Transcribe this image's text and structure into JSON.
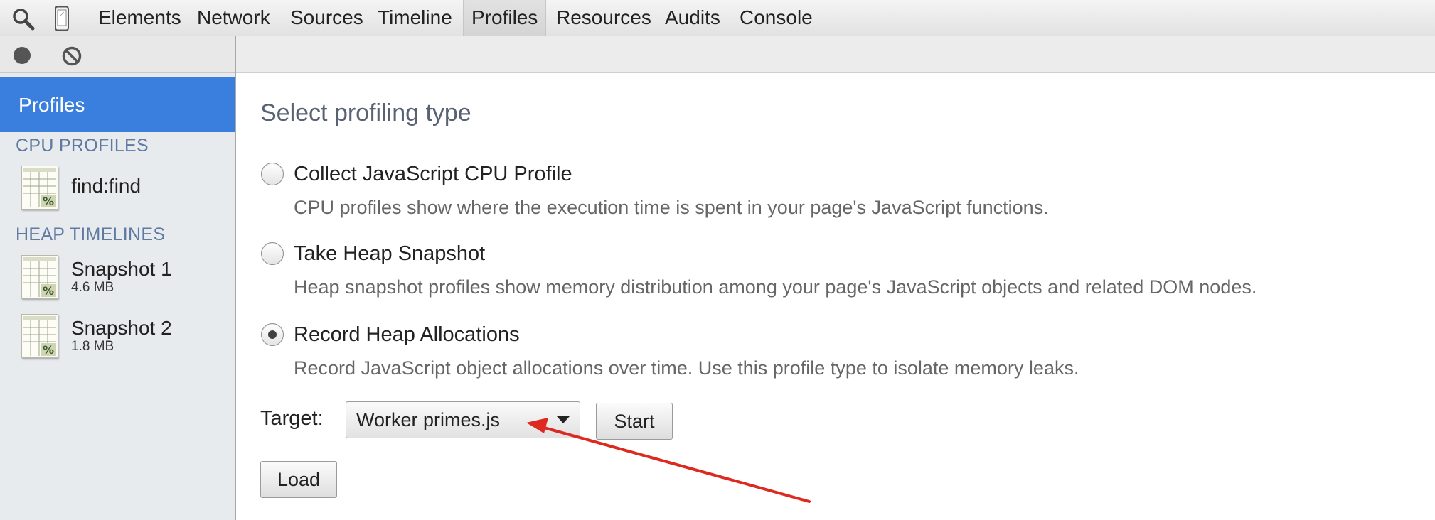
{
  "toolbar": {
    "icons": [
      "search-icon",
      "device-mode-icon"
    ],
    "tabs": [
      {
        "label": "Elements"
      },
      {
        "label": "Network"
      },
      {
        "label": "Sources"
      },
      {
        "label": "Timeline"
      },
      {
        "label": "Profiles",
        "active": true
      },
      {
        "label": "Resources"
      },
      {
        "label": "Audits"
      },
      {
        "label": "Console"
      }
    ]
  },
  "sidebar": {
    "toolbar_icons": [
      "record-icon",
      "clear-icon"
    ],
    "selected": "Profiles",
    "sections": [
      {
        "title": "CPU PROFILES",
        "items": [
          {
            "title": "find:find",
            "icon": "profile-icon"
          }
        ]
      },
      {
        "title": "HEAP TIMELINES",
        "items": [
          {
            "title": "Snapshot 1",
            "subtitle": "4.6 MB",
            "icon": "profile-icon"
          },
          {
            "title": "Snapshot 2",
            "subtitle": "1.8 MB",
            "icon": "profile-icon"
          }
        ]
      }
    ]
  },
  "main": {
    "title": "Select profiling type",
    "options": [
      {
        "label": "Collect JavaScript CPU Profile",
        "description": "CPU profiles show where the execution time is spent in your page's JavaScript functions.",
        "selected": false
      },
      {
        "label": "Take Heap Snapshot",
        "description": "Heap snapshot profiles show memory distribution among your page's JavaScript objects and related DOM nodes.",
        "selected": false
      },
      {
        "label": "Record Heap Allocations",
        "description": "Record JavaScript object allocations over time. Use this profile type to isolate memory leaks.",
        "selected": true
      }
    ],
    "target_label": "Target:",
    "target_value": "Worker primes.js",
    "start_label": "Start",
    "load_label": "Load"
  },
  "colors": {
    "selection": "#3b7fde",
    "annotation_arrow": "#dd2a20",
    "section_header": "#5f7aa0"
  }
}
